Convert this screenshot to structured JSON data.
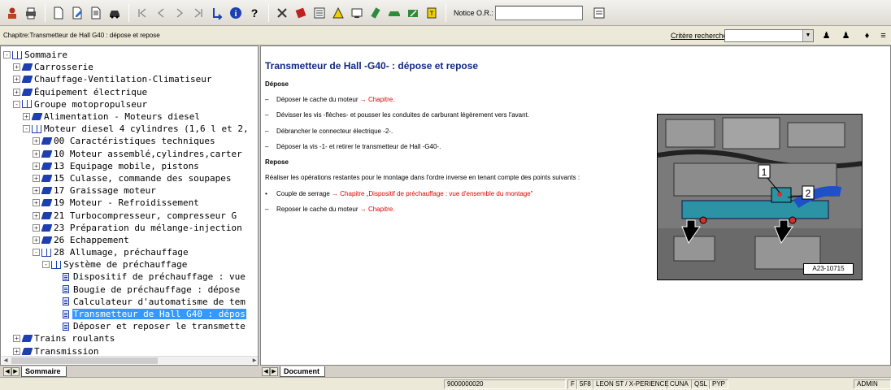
{
  "toolbar": {
    "icons": [
      "person-icon",
      "print-icon",
      "new-document-icon",
      "edit-document-icon",
      "document-icon",
      "car-icon",
      "first-icon",
      "previous-icon",
      "next-icon",
      "last-icon",
      "back-link-icon",
      "info-icon",
      "help-icon",
      "tools-icon",
      "book-icon",
      "list-icon",
      "warning-icon",
      "screen-icon",
      "pen-icon",
      "car-green-icon",
      "car-repair-icon",
      "key-icon"
    ],
    "info_glyph": "i",
    "help_glyph": "?",
    "notice_label": "Notice O.R.:",
    "notice_value": ""
  },
  "header": {
    "chapter": "Chapitre:Transmetteur de Hall G40 : dépose et repose",
    "criteria_label": "Critère recherche:",
    "criteria_value": ""
  },
  "tree": {
    "items": [
      {
        "label": "Sommaire",
        "level": 0,
        "icon": "open",
        "exp": "-"
      },
      {
        "label": "Carrosserie",
        "level": 1,
        "icon": "closed",
        "exp": "+"
      },
      {
        "label": "Chauffage-Ventilation-Climatiseur",
        "level": 1,
        "icon": "closed",
        "exp": "+"
      },
      {
        "label": "Équipement électrique",
        "level": 1,
        "icon": "closed",
        "exp": "+"
      },
      {
        "label": "Groupe motopropulseur",
        "level": 1,
        "icon": "open",
        "exp": "-"
      },
      {
        "label": "Alimentation - Moteurs diesel",
        "level": 2,
        "icon": "closed",
        "exp": "+"
      },
      {
        "label": "Moteur diesel 4 cylindres (1,6 l et 2,",
        "level": 2,
        "icon": "open",
        "exp": "-"
      },
      {
        "label": "00 Caractéristiques techniques",
        "level": 3,
        "icon": "closed",
        "exp": "+"
      },
      {
        "label": "10 Moteur assemblé,cylindres,carter",
        "level": 3,
        "icon": "closed",
        "exp": "+"
      },
      {
        "label": "13 Equipage mobile, pistons",
        "level": 3,
        "icon": "closed",
        "exp": "+"
      },
      {
        "label": "15 Culasse, commande des soupapes",
        "level": 3,
        "icon": "closed",
        "exp": "+"
      },
      {
        "label": "17 Graissage moteur",
        "level": 3,
        "icon": "closed",
        "exp": "+"
      },
      {
        "label": "19 Moteur - Refroidissement",
        "level": 3,
        "icon": "closed",
        "exp": "+"
      },
      {
        "label": "21 Turbocompresseur, compresseur G",
        "level": 3,
        "icon": "closed",
        "exp": "+"
      },
      {
        "label": "23 Préparation du mélange-injection",
        "level": 3,
        "icon": "closed",
        "exp": "+"
      },
      {
        "label": "26 Echappement",
        "level": 3,
        "icon": "closed",
        "exp": "+"
      },
      {
        "label": "28 Allumage, préchauffage",
        "level": 3,
        "icon": "open",
        "exp": "-"
      },
      {
        "label": "Système de préchauffage",
        "level": 4,
        "icon": "open",
        "exp": "-"
      },
      {
        "label": "Dispositif de préchauffage : vue",
        "level": 5,
        "icon": "doc",
        "exp": ""
      },
      {
        "label": "Bougie de préchauffage : dépose",
        "level": 5,
        "icon": "doc",
        "exp": ""
      },
      {
        "label": "Calculateur d'automatisme de tem",
        "level": 5,
        "icon": "doc",
        "exp": ""
      },
      {
        "label": "Transmetteur de Hall G40 : dépos",
        "level": 5,
        "icon": "doc",
        "exp": "",
        "selected": true
      },
      {
        "label": "Déposer et reposer le transmette",
        "level": 5,
        "icon": "doc",
        "exp": ""
      },
      {
        "label": "Trains roulants",
        "level": 1,
        "icon": "closed",
        "exp": "+"
      },
      {
        "label": "Transmission",
        "level": 1,
        "icon": "closed",
        "exp": "+"
      }
    ]
  },
  "tabs": {
    "left": "Sommaire",
    "right": "Document"
  },
  "document": {
    "title": "Transmetteur de Hall -G40- : dépose et repose",
    "depose_heading": "Dépose",
    "steps_depose": [
      {
        "text": "Déposer le cache du moteur ",
        "link": "→ Chapitre."
      },
      {
        "text": "Dévisser les vis -flèches- et pousser les conduites de carburant légèrement vers l'avant.",
        "link": ""
      },
      {
        "text": "Débrancher le connecteur électrique -2-.",
        "link": ""
      },
      {
        "text": "Déposer la vis -1- et retirer le transmetteur de Hall -G40-.",
        "link": ""
      }
    ],
    "repose_heading": "Repose",
    "repose_intro": "Réaliser les opérations restantes pour le montage dans l'ordre inverse en tenant compte des points suivants :",
    "bullet_text": "Couple de serrage ",
    "bullet_link": "→ Chapitre „Dispositif de préchauffage : vue d'ensemble du montage\"",
    "last_step_text": "Reposer le cache du moteur ",
    "last_step_link": "→ Chapitre.",
    "dash": "–",
    "bullet": "•",
    "figure": {
      "callout_1": "1",
      "callout_2": "2",
      "label": "A23-10715"
    }
  },
  "status": {
    "code": "9000000020",
    "f": "F",
    "f8": "5F8",
    "vehicle": "LEON ST / X-PERIENCE",
    "cuna": "CUNA",
    "qsl": "QSL",
    "pyp": "PYP",
    "user": "ADMIN"
  },
  "colors": {
    "title": "#102a80",
    "link": "#e00000",
    "selection": "#3399ff",
    "book": "#1e3faf"
  }
}
